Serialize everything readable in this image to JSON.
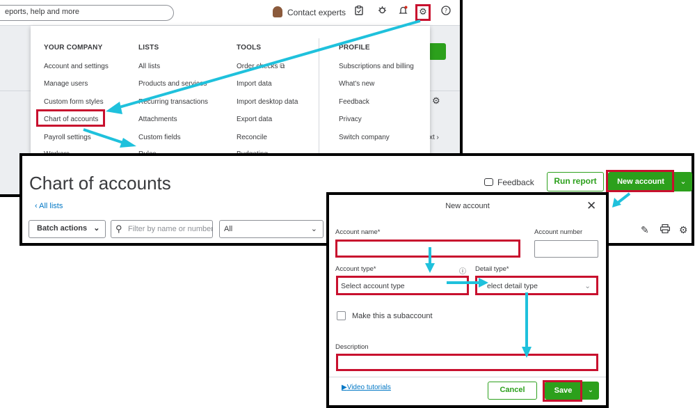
{
  "topbar": {
    "search_placeholder": "eports, help and more",
    "contact_label": "Contact experts",
    "icons": [
      "clipboard-icon",
      "bug-icon",
      "bell-icon",
      "gear-icon",
      "help-icon"
    ]
  },
  "settings_menu": {
    "columns": [
      {
        "heading": "YOUR COMPANY",
        "items": [
          "Account and settings",
          "Manage users",
          "Custom form styles",
          "Chart of accounts",
          "Payroll settings",
          "Workers"
        ]
      },
      {
        "heading": "LISTS",
        "items": [
          "All lists",
          "Products and services",
          "Recurring transactions",
          "Attachments",
          "Custom fields",
          "Rules"
        ]
      },
      {
        "heading": "TOOLS",
        "items": [
          "Order checks",
          "Import data",
          "Import desktop data",
          "Export data",
          "Reconcile",
          "Budgeting"
        ]
      },
      {
        "heading": "PROFILE",
        "items": [
          "Subscriptions and billing",
          "What's new",
          "Feedback",
          "Privacy",
          "Switch company"
        ]
      }
    ],
    "background_next": "xt"
  },
  "chart_page": {
    "title": "Chart of accounts",
    "back_link": "All lists",
    "feedback_label": "Feedback",
    "run_report_label": "Run report",
    "new_account_label": "New account",
    "batch_actions_label": "Batch actions",
    "filter_placeholder": "Filter by name or number",
    "all_select_value": "All"
  },
  "new_account_modal": {
    "title": "New account",
    "account_name_label": "Account name*",
    "account_number_label": "Account number",
    "account_type_label": "Account type*",
    "account_type_placeholder": "Select account type",
    "detail_type_label": "Detail type*",
    "detail_type_placeholder": "elect detail type",
    "subaccount_label": "Make this a subaccount",
    "description_label": "Description",
    "video_link": "Video tutorials",
    "cancel_label": "Cancel",
    "save_label": "Save"
  },
  "colors": {
    "brand_green": "#2ca01c",
    "highlight_red": "#c8102e",
    "arrow_cyan": "#1fc1dc",
    "link_blue": "#0077c5"
  }
}
